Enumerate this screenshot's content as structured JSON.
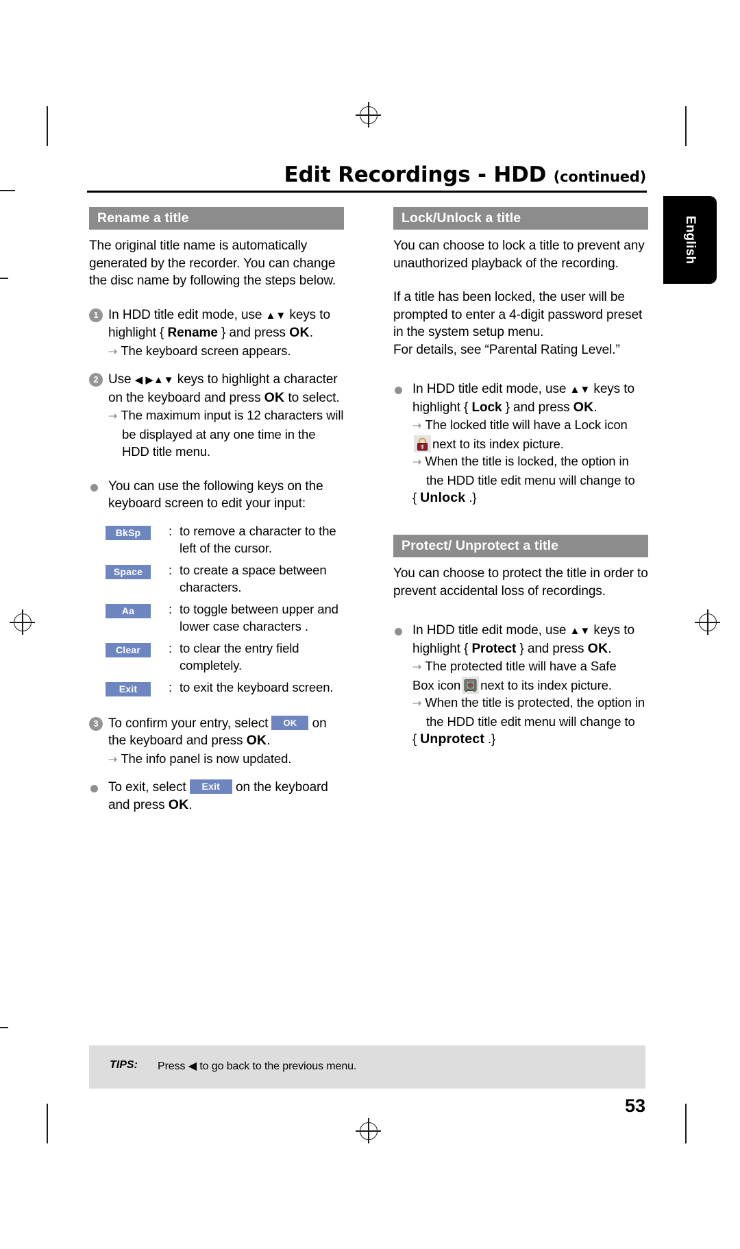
{
  "header": {
    "title": "Edit Recordings - HDD",
    "continued": "(continued)"
  },
  "lang_tab": {
    "label": "English"
  },
  "colors": {
    "section_header_bg": "#8c8c8c",
    "key_chip_bg": "#6e86c0",
    "tips_bg": "#dddddd",
    "step_number_bg": "#949494",
    "lock_icon": "#8f1d24",
    "safe_icon": "#7b8378"
  },
  "left_column": {
    "section1": {
      "heading": "Rename a title",
      "intro": "The original title name is automatically generated by the recorder. You can change the disc name by following the steps below.",
      "steps": [
        {
          "num": "1",
          "text_before": "In HDD title edit mode, use ",
          "keys": "▲▼",
          "text_mid": " keys to highlight { ",
          "bold1": "Rename",
          "text_mid2": " } and press ",
          "bold2": "OK",
          "text_after": ".",
          "sub": "The keyboard screen appears."
        },
        {
          "num": "2",
          "text_before": "Use ",
          "keys": "◀ ▶▲▼",
          "text_mid": " keys to highlight a character on the keyboard and press ",
          "bold2": "OK",
          "text_after": " to select.",
          "sub": "The maximum input is 12 characters will be displayed at any one time in the HDD title menu."
        }
      ],
      "keys_bullet": "You can use the following keys on the keyboard screen to edit your input:",
      "key_legend": [
        {
          "key": "BkSp",
          "desc": "to remove a character to the left of the cursor."
        },
        {
          "key": "Space",
          "desc": "to create a space between characters."
        },
        {
          "key": "Aa",
          "desc": "to toggle between upper and lower case characters ."
        },
        {
          "key": "Clear",
          "desc": "to clear the entry field completely."
        },
        {
          "key": "Exit",
          "desc": "to exit the keyboard screen."
        }
      ],
      "step3": {
        "num": "3",
        "text_before": "To confirm your entry, select ",
        "chip": "OK",
        "text_mid": " on the keyboard and press ",
        "bold": "OK",
        "text_after": ".",
        "sub": "The info panel is now updated."
      },
      "exit_bullet": {
        "text_before": "To exit, select ",
        "chip": "Exit",
        "text_mid": " on the keyboard and press ",
        "bold": "OK",
        "text_after": "."
      }
    }
  },
  "right_column": {
    "section_lock": {
      "heading": "Lock/Unlock a title",
      "para1": "You can choose to lock a title to prevent any unauthorized playback of the recording.",
      "para2": "If a title has been locked, the user will be prompted to enter a 4-digit password preset in the system setup menu.",
      "para2b": "For details, see “Parental Rating Level.”",
      "bullet": {
        "text_before": "In HDD title edit mode, use ",
        "keys": "▲▼",
        "text_mid": " keys to highlight { ",
        "bold1": "Lock",
        "text_mid2": " } and press ",
        "bold2": "OK",
        "text_after": ".",
        "sub1_a": "The locked title will have a Lock icon",
        "sub1_icon": "lock-icon",
        "sub1_b": "next to its index picture.",
        "sub2_a": "When the title is locked, the option in the HDD title edit menu will change to",
        "sub2_brace_open": "{ ",
        "sub2_bold": "Unlock",
        "sub2_brace_close": " .}"
      }
    },
    "section_protect": {
      "heading": "Protect/ Unprotect a title",
      "para1": "You can choose to protect the title in order to prevent accidental loss of recordings.",
      "bullet": {
        "text_before": "In HDD title edit mode, use ",
        "keys": "▲▼",
        "text_mid": " keys to highlight { ",
        "bold1": "Protect",
        "text_mid2": " } and press ",
        "bold2": "OK",
        "text_after": ".",
        "sub1_a": "The protected title will have a Safe",
        "sub1_b": "Box icon",
        "sub1_icon": "safe-box-icon",
        "sub1_c": "next to its index picture.",
        "sub2_a": "When the title is protected, the option in the HDD title edit menu will change to",
        "sub2_brace_open": "{ ",
        "sub2_bold": "Unprotect",
        "sub2_brace_close": " .}"
      }
    }
  },
  "tips": {
    "label": "TIPS:",
    "text_before": "Press ",
    "arrow": "◀",
    "text_after": " to go back to the previous menu."
  },
  "page_number": "53"
}
